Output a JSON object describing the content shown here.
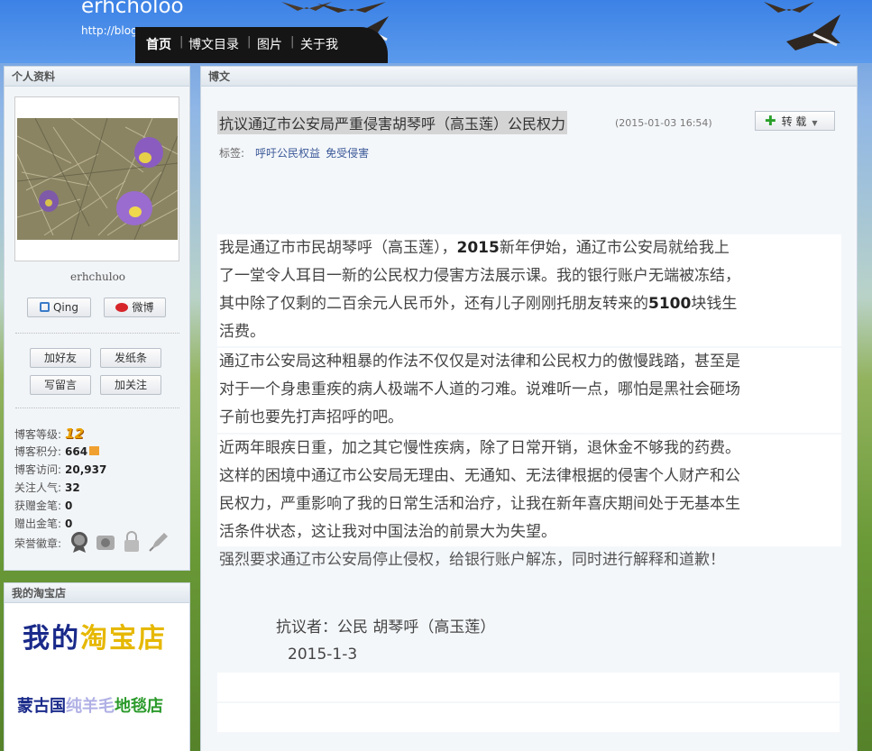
{
  "header": {
    "blog_title": "erhcholoo",
    "blog_url": "http://blog.s",
    "nav": [
      "首页",
      "博文目录",
      "图片",
      "关于我"
    ],
    "separator": "|"
  },
  "sidebar": {
    "profile_title": "个人资料",
    "nickname": "erhchuloo",
    "qing_label": "Qing",
    "weibo_label": "微博",
    "actions": [
      "加好友",
      "发纸条",
      "写留言",
      "加关注"
    ],
    "stats": [
      {
        "label": "博客等级:",
        "value": "12"
      },
      {
        "label": "博客积分:",
        "value": "664"
      },
      {
        "label": "博客访问:",
        "value": "20,937"
      },
      {
        "label": "关注人气:",
        "value": "32"
      },
      {
        "label": "获赠金笔:",
        "value": "0"
      },
      {
        "label": "赠出金笔:",
        "value": "0"
      },
      {
        "label": "荣誉徽章:",
        "value": ""
      }
    ],
    "badge_icons": [
      "medal-icon",
      "camera-icon",
      "lock-icon",
      "pen-icon"
    ],
    "shop_title": "我的淘宝店",
    "shop_banner": [
      "我的",
      "淘宝店"
    ],
    "shop_banner2": [
      "蒙古国",
      "纯羊毛",
      "地毯店"
    ]
  },
  "article": {
    "section_title": "博文",
    "title": "抗议通辽市公安局严重侵害胡琴呼（高玉莲）公民权力",
    "time": "(2015-01-03 16:54)",
    "share_label": "转 载",
    "tags_label": "标签:",
    "tags": [
      "呼吁公民权益",
      "免受侵害"
    ],
    "p1_line1": [
      "我是通辽市市民胡琴呼（高玉莲），",
      "2015",
      "新年伊始，通辽市公安局就给我上"
    ],
    "p1_line2": "了一堂令人耳目一新的公民权力侵害方法展示课。我的银行账户无端被冻结，",
    "p1_line3": [
      "其中除了仅剩的二百余元人民币外，还有儿子刚刚托朋友转来的",
      "5100",
      "块钱生"
    ],
    "p1_line4": "活费。",
    "p2": [
      "通辽市公安局这种粗暴的作法不仅仅是对法律和公民权力的傲慢践踏，甚至是",
      "对于一个身患重疾的病人极端不人道的刁难。说难听一点，哪怕是黑社会砸场",
      "子前也要先打声招呼的吧。"
    ],
    "p3": [
      "近两年眼疾日重，加之其它慢性疾病，除了日常开销，退休金不够我的药费。",
      "这样的困境中通辽市公安局无理由、无通知、无法律根据的侵害个人财产和公",
      "民权力，严重影响了我的日常生活和治疗，让我在新年喜庆期间处于无基本生",
      "活条件状态，这让我对中国法治的前景大为失望。"
    ],
    "p4": "强烈要求通辽市公安局停止侵权，给银行账户解冻，同时进行解释和道歉！",
    "signer": "抗议者：公民 胡琴呼（高玉莲）",
    "date": "2015-1-3"
  }
}
